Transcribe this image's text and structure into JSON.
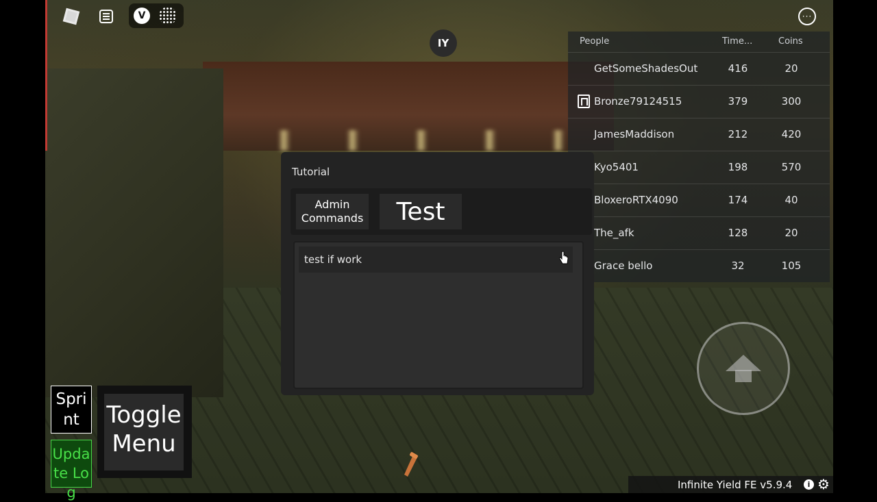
{
  "topbar": {
    "iy_badge": "IY"
  },
  "leaderboard": {
    "headers": {
      "people": "People",
      "time": "Time...",
      "coins": "Coins"
    },
    "rows": [
      {
        "name": "GetSomeShadesOut",
        "time": "416",
        "coins": "20",
        "premium": false
      },
      {
        "name": "Bronze79124515",
        "time": "379",
        "coins": "300",
        "premium": true
      },
      {
        "name": "JamesMaddison",
        "time": "212",
        "coins": "420",
        "premium": false
      },
      {
        "name": "Kyo5401",
        "time": "198",
        "coins": "570",
        "premium": false
      },
      {
        "name": "BloxeroRTX4090",
        "time": "174",
        "coins": "40",
        "premium": true
      },
      {
        "name": "The_afk",
        "time": "128",
        "coins": "20",
        "premium": false
      },
      {
        "name": "Grace bello",
        "time": "32",
        "coins": "105",
        "premium": false
      }
    ]
  },
  "tutorial": {
    "title": "Tutorial",
    "tabs": {
      "admin": "Admin Commands",
      "test": "Test"
    },
    "content": "test if work"
  },
  "controls": {
    "sprint": "Sprint",
    "update_log": "Update Log",
    "toggle_menu": "Toggle Menu"
  },
  "footer": {
    "version": "Infinite Yield FE v5.9.4",
    "info_glyph": "i",
    "gear_glyph": "⚙"
  },
  "icons": {
    "roblox": "roblox-logo-icon",
    "chat": "chat-icon",
    "voice": "voice-chat-icon",
    "mic": "mic-level-icon",
    "more": "more-options-icon",
    "jump": "jump-arrow-icon",
    "premium": "premium-icon"
  }
}
